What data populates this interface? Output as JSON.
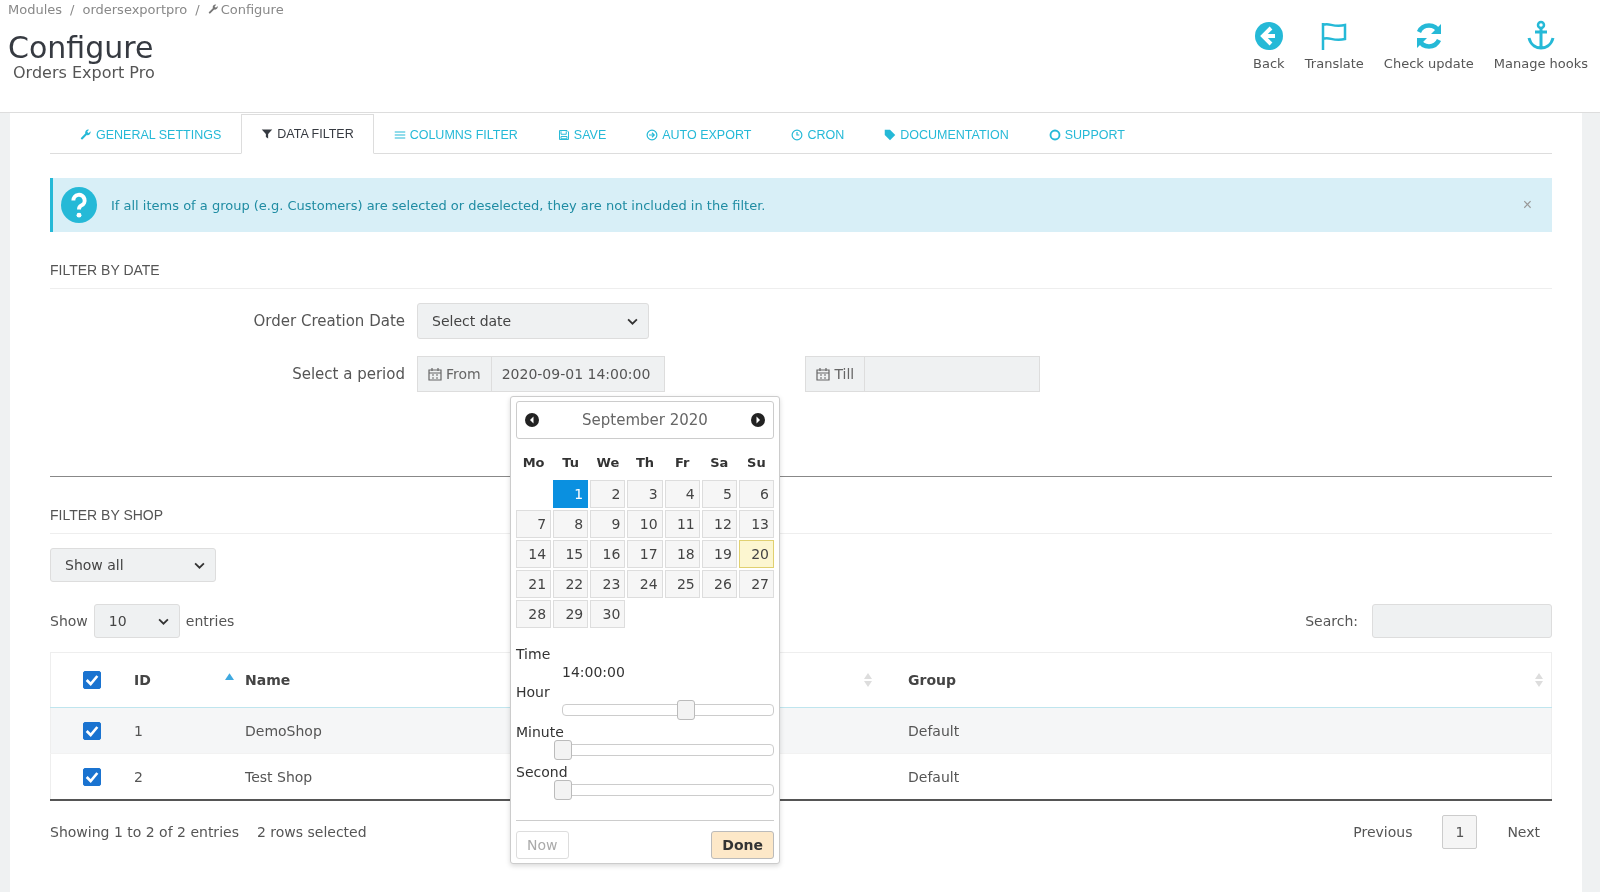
{
  "breadcrumb": [
    "Modules",
    "ordersexportpro",
    "Configure"
  ],
  "breadcrumb_separator": "/",
  "title": "Configure",
  "subtitle": "Orders Export Pro",
  "toolbar": [
    {
      "kind": "back",
      "label": "Back"
    },
    {
      "kind": "flag",
      "label": "Translate"
    },
    {
      "kind": "refresh",
      "label": "Check update"
    },
    {
      "kind": "anchor",
      "label": "Manage hooks"
    }
  ],
  "tabs": [
    {
      "kind": "wrench",
      "label": "GENERAL SETTINGS",
      "selected": false
    },
    {
      "kind": "filter",
      "label": "DATA FILTER",
      "selected": true
    },
    {
      "kind": "sliders",
      "label": "COLUMNS FILTER",
      "selected": false
    },
    {
      "kind": "save",
      "label": "SAVE",
      "selected": false
    },
    {
      "kind": "circle-arrow",
      "label": "AUTO EXPORT",
      "selected": false
    },
    {
      "kind": "clock",
      "label": "CRON",
      "selected": false
    },
    {
      "kind": "tag",
      "label": "DOCUMENTATION",
      "selected": false
    },
    {
      "kind": "lifebuoy",
      "label": "SUPPORT",
      "selected": false
    }
  ],
  "alert": {
    "text": "If all items of a group (e.g. Customers) are selected or deselected, they are not included in the filter.",
    "close": "×"
  },
  "filter_by_date": {
    "heading": "FILTER BY DATE",
    "order_creation_label": "Order Creation Date",
    "order_creation_value": "Select date",
    "period_label": "Select a period",
    "from_label": "From",
    "from_value": "2020-09-01 14:00:00",
    "till_label": "Till"
  },
  "datepicker": {
    "month": "September 2020",
    "weekdays": [
      "Mo",
      "Tu",
      "We",
      "Th",
      "Fr",
      "Sa",
      "Su"
    ],
    "weeks": [
      [
        {
          "kind": "blank"
        },
        {
          "kind": "day",
          "day": "1",
          "selected": true,
          "today": false
        },
        {
          "kind": "day",
          "day": "2",
          "selected": false,
          "today": false
        },
        {
          "kind": "day",
          "day": "3",
          "selected": false,
          "today": false
        },
        {
          "kind": "day",
          "day": "4",
          "selected": false,
          "today": false
        },
        {
          "kind": "day",
          "day": "5",
          "selected": false,
          "today": false
        },
        {
          "kind": "day",
          "day": "6",
          "selected": false,
          "today": false
        }
      ],
      [
        {
          "kind": "day",
          "day": "7",
          "selected": false,
          "today": false
        },
        {
          "kind": "day",
          "day": "8",
          "selected": false,
          "today": false
        },
        {
          "kind": "day",
          "day": "9",
          "selected": false,
          "today": false
        },
        {
          "kind": "day",
          "day": "10",
          "selected": false,
          "today": false
        },
        {
          "kind": "day",
          "day": "11",
          "selected": false,
          "today": false
        },
        {
          "kind": "day",
          "day": "12",
          "selected": false,
          "today": false
        },
        {
          "kind": "day",
          "day": "13",
          "selected": false,
          "today": false
        }
      ],
      [
        {
          "kind": "day",
          "day": "14",
          "selected": false,
          "today": false
        },
        {
          "kind": "day",
          "day": "15",
          "selected": false,
          "today": false
        },
        {
          "kind": "day",
          "day": "16",
          "selected": false,
          "today": false
        },
        {
          "kind": "day",
          "day": "17",
          "selected": false,
          "today": false
        },
        {
          "kind": "day",
          "day": "18",
          "selected": false,
          "today": false
        },
        {
          "kind": "day",
          "day": "19",
          "selected": false,
          "today": false
        },
        {
          "kind": "day",
          "day": "20",
          "selected": false,
          "today": true
        }
      ],
      [
        {
          "kind": "day",
          "day": "21",
          "selected": false,
          "today": false
        },
        {
          "kind": "day",
          "day": "22",
          "selected": false,
          "today": false
        },
        {
          "kind": "day",
          "day": "23",
          "selected": false,
          "today": false
        },
        {
          "kind": "day",
          "day": "24",
          "selected": false,
          "today": false
        },
        {
          "kind": "day",
          "day": "25",
          "selected": false,
          "today": false
        },
        {
          "kind": "day",
          "day": "26",
          "selected": false,
          "today": false
        },
        {
          "kind": "day",
          "day": "27",
          "selected": false,
          "today": false
        }
      ],
      [
        {
          "kind": "day",
          "day": "28",
          "selected": false,
          "today": false
        },
        {
          "kind": "day",
          "day": "29",
          "selected": false,
          "today": false
        },
        {
          "kind": "day",
          "day": "30",
          "selected": false,
          "today": false
        }
      ]
    ],
    "time_label": "Time",
    "time_value": "14:00:00",
    "sliders": [
      {
        "label": "Hour",
        "level": 0.61
      },
      {
        "label": "Minute",
        "level": 0
      },
      {
        "label": "Second",
        "level": 0
      }
    ],
    "now_button": "Now",
    "done_button": "Done"
  },
  "filter_by_shop": {
    "heading": "FILTER BY SHOP",
    "shop_select": "Show all",
    "show_label": "Show",
    "page_size": "10",
    "entries_label": "entries",
    "search_label": "Search:"
  },
  "table": {
    "all_checked": true,
    "columns": [
      "ID",
      "Name",
      "Group"
    ],
    "rows": [
      {
        "checked": true,
        "id": "1",
        "name": "DemoShop",
        "group": "Default"
      },
      {
        "checked": true,
        "id": "2",
        "name": "Test Shop",
        "group": "Default"
      }
    ],
    "info": "Showing 1 to 2 of 2 entries",
    "selection_info": "2 rows selected"
  },
  "pagination": {
    "previous": "Previous",
    "page": "1",
    "next": "Next"
  }
}
